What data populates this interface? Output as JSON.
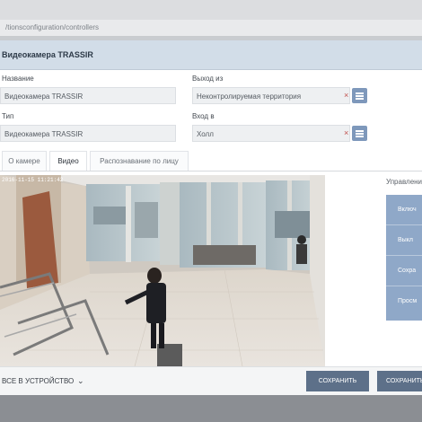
{
  "browser": {
    "url": "/tionsconfiguration/controllers"
  },
  "dialog": {
    "title": "Видеокамера TRASSIR",
    "fields": {
      "name_label": "Название",
      "name_value": "Видеокамера TRASSIR",
      "exit_label": "Выход из",
      "exit_value": "Неконтролируемая территория",
      "type_label": "Тип",
      "type_value": "Видеокамера TRASSIR",
      "entry_label": "Вход в",
      "entry_value": "Холл",
      "clear_glyph": "×"
    },
    "tabs": [
      {
        "label": "О камере",
        "active": false
      },
      {
        "label": "Видео",
        "active": true
      },
      {
        "label": "Распознавание по лицу",
        "active": false
      }
    ],
    "video": {
      "timestamp": "2016-11-15 11:21:42"
    },
    "controls": {
      "title": "Управление",
      "buttons": [
        "Включ",
        "Выкл",
        "Сохра",
        "Просм"
      ]
    },
    "bottom": {
      "dropdown_label": "ВСЕ В УСТРОЙСТВО",
      "chevron": "⌄",
      "save_label": "СОХРАНИТЬ",
      "save_close_label": "СОХРАНИТЬ И ЗАКРЫТЬ"
    }
  }
}
